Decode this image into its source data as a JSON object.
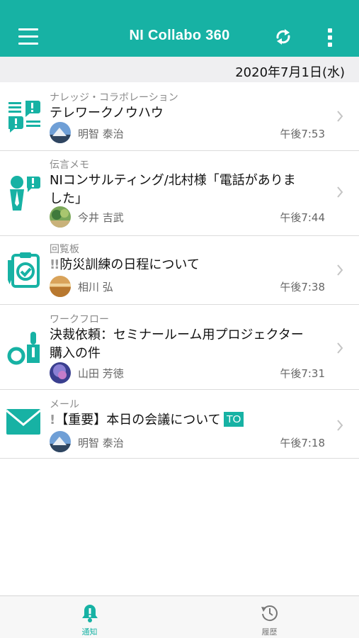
{
  "header": {
    "title": "NI Collabo 360",
    "menu_icon": "hamburger-menu-icon",
    "refresh_icon": "refresh-icon",
    "more_icon": "more-vertical-icon"
  },
  "date_bar": {
    "date": "2020年7月1日(水)"
  },
  "notifications": [
    {
      "category": "ナレッジ・コラボレーション",
      "subject": "テレワークノウハウ",
      "sender": "明智 泰治",
      "time": "午後7:53",
      "icon": "knowledge-collaboration-icon"
    },
    {
      "category": "伝言メモ",
      "subject_line1": "NIコンサルティング/北村様「電話がありま",
      "subject_line2": "した」",
      "sender": "今井 吉武",
      "time": "午後7:44",
      "icon": "message-memo-icon"
    },
    {
      "category": "回覧板",
      "priority_mark": "!!",
      "subject": "防災訓練の日程について",
      "sender": "相川 弘",
      "time": "午後7:38",
      "icon": "circular-board-icon"
    },
    {
      "category": "ワークフロー",
      "subject_line1": "決裁依頼：セミナールーム用プロジェクター",
      "subject_line2": "購入の件",
      "sender": "山田 芳徳",
      "time": "午後7:31",
      "icon": "workflow-stamp-icon"
    },
    {
      "category": "メール",
      "priority_mark": "!",
      "subject": "【重要】本日の会議について",
      "badge": "TO",
      "sender": "明智 泰治",
      "time": "午後7:18",
      "icon": "mail-envelope-icon"
    }
  ],
  "tabs": [
    {
      "label": "通知",
      "icon": "notification-bell-icon",
      "active": true
    },
    {
      "label": "履歴",
      "icon": "history-clock-icon",
      "active": false
    }
  ],
  "colors": {
    "accent": "#17b2a4",
    "date_bar_bg": "#efeff1",
    "muted_text": "#8a8a8a",
    "inactive_tab": "#777777"
  }
}
